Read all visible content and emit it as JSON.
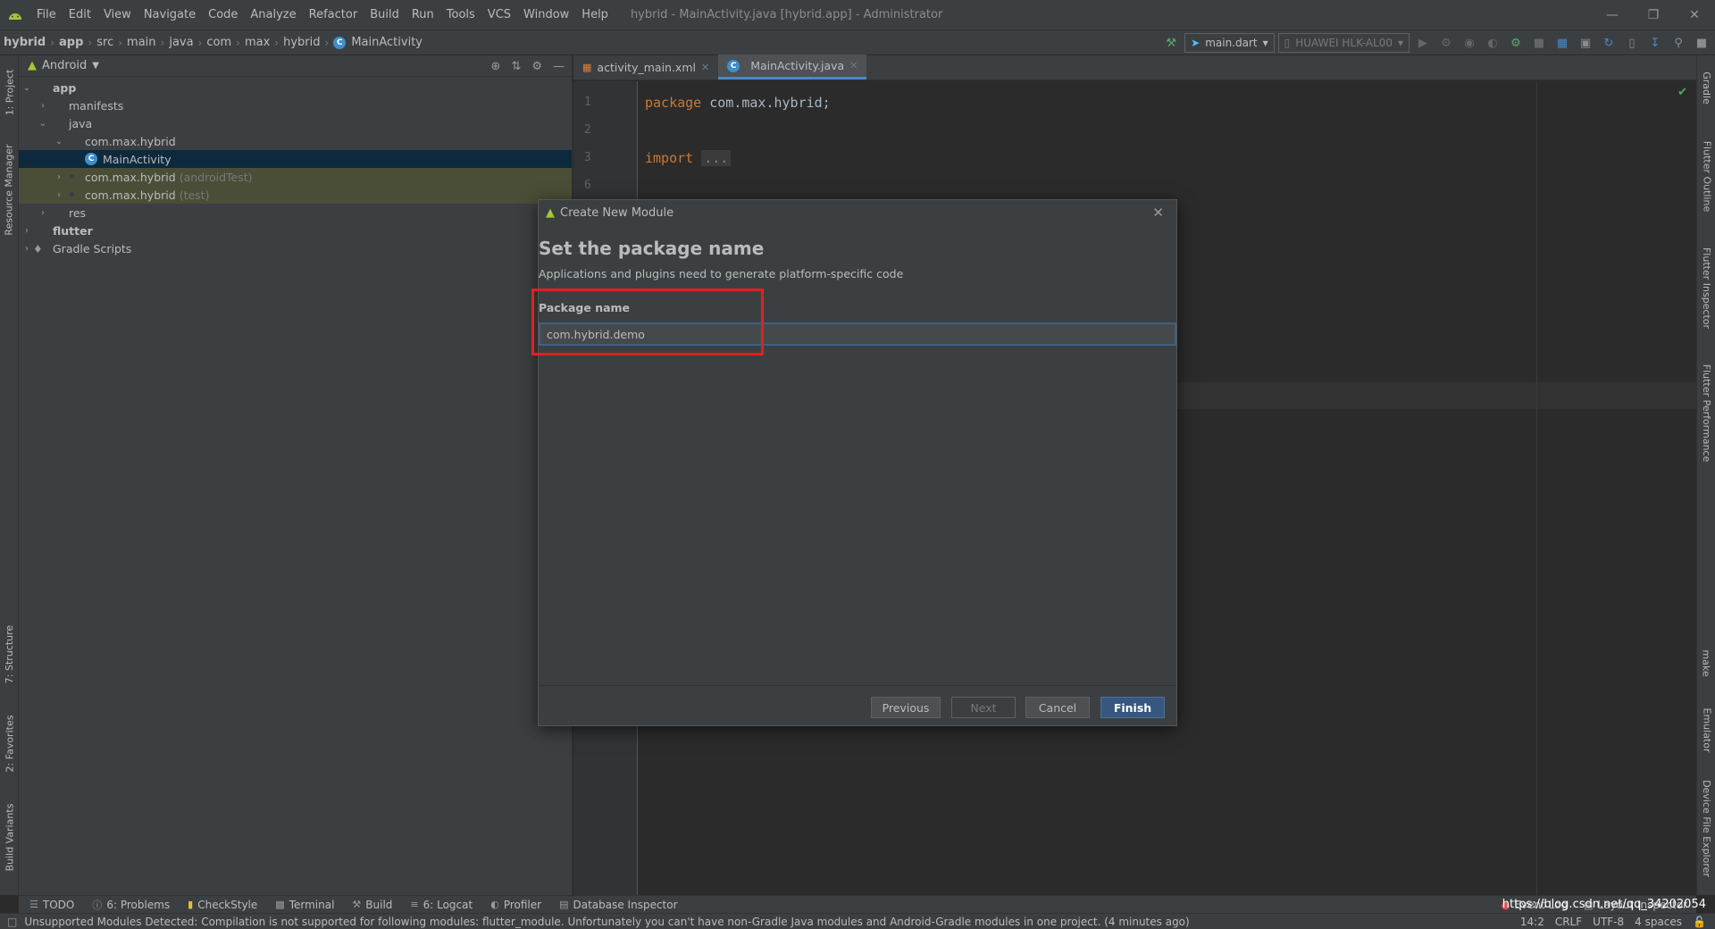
{
  "menubar": {
    "items": [
      "File",
      "Edit",
      "View",
      "Navigate",
      "Code",
      "Analyze",
      "Refactor",
      "Build",
      "Run",
      "Tools",
      "VCS",
      "Window",
      "Help"
    ],
    "window_title": "hybrid - MainActivity.java [hybrid.app] - Administrator"
  },
  "breadcrumb": [
    "hybrid",
    "app",
    "src",
    "main",
    "java",
    "com",
    "max",
    "hybrid",
    "MainActivity"
  ],
  "toolbar": {
    "run_config": "main.dart",
    "device": "HUAWEI HLK-AL00"
  },
  "left_tabs": [
    "1: Project",
    "Resource Manager",
    "7: Structure",
    "2: Favorites",
    "Build Variants"
  ],
  "right_tabs": [
    "Gradle",
    "Flutter Outline",
    "Flutter Inspector",
    "Flutter Performance",
    "make",
    "Emulator",
    "Device File Explorer"
  ],
  "project": {
    "view_mode": "Android",
    "tree": [
      {
        "label": "app",
        "suffix": ""
      },
      {
        "label": "manifests",
        "suffix": ""
      },
      {
        "label": "java",
        "suffix": ""
      },
      {
        "label": "com.max.hybrid",
        "suffix": ""
      },
      {
        "label": "MainActivity",
        "suffix": ""
      },
      {
        "label": "com.max.hybrid",
        "suffix": "(androidTest)"
      },
      {
        "label": "com.max.hybrid",
        "suffix": "(test)"
      },
      {
        "label": "res",
        "suffix": ""
      },
      {
        "label": "flutter",
        "suffix": ""
      },
      {
        "label": "Gradle Scripts",
        "suffix": ""
      }
    ]
  },
  "editor": {
    "tabs": [
      "activity_main.xml",
      "MainActivity.java"
    ],
    "line_numbers": [
      "1",
      "2",
      "3",
      "6"
    ],
    "code": {
      "line1_kw": "package",
      "line1_rest": " com.max.hybrid;",
      "line3_kw": "import",
      "line3_fold": "..."
    }
  },
  "dialog": {
    "title": "Create New Module",
    "heading": "Set the package name",
    "subtitle": "Applications and plugins need to generate platform-specific code",
    "field_label": "Package name",
    "field_value": "com.hybrid.demo",
    "buttons": {
      "previous": "Previous",
      "next": "Next",
      "cancel": "Cancel",
      "finish": "Finish"
    }
  },
  "bottom_tools": [
    "TODO",
    "6: Problems",
    "CheckStyle",
    "Terminal",
    "Build",
    "6: Logcat",
    "Profiler",
    "Database Inspector"
  ],
  "bottom_right": [
    "Event Log",
    "Layout Inspector"
  ],
  "status": {
    "message": "Unsupported Modules Detected: Compilation is not supported for following modules: flutter_module. Unfortunately you can't have non-Gradle Java modules and Android-Gradle modules in one project. (4 minutes ago)",
    "position": "14:2",
    "line_sep": "CRLF",
    "encoding": "UTF-8",
    "indent": "4 spaces"
  },
  "watermark": "https://blog.csdn.net/qq_34202054"
}
